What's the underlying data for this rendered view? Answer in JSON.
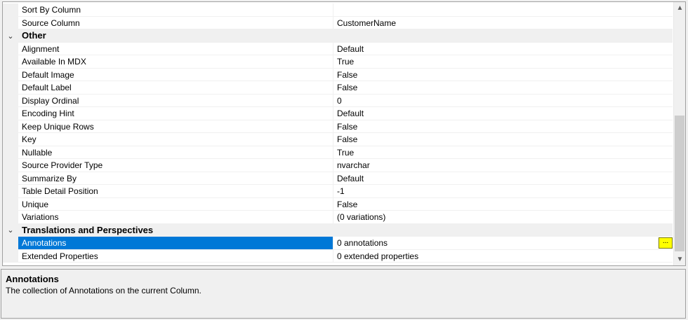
{
  "grid": {
    "rows": [
      {
        "type": "property",
        "name": "Sort By Column",
        "value": ""
      },
      {
        "type": "property",
        "name": "Source Column",
        "value": "CustomerName"
      },
      {
        "type": "category",
        "name": "Other",
        "toggle": "⌄"
      },
      {
        "type": "property",
        "name": "Alignment",
        "value": "Default"
      },
      {
        "type": "property",
        "name": "Available In MDX",
        "value": "True"
      },
      {
        "type": "property",
        "name": "Default Image",
        "value": "False"
      },
      {
        "type": "property",
        "name": "Default Label",
        "value": "False"
      },
      {
        "type": "property",
        "name": "Display Ordinal",
        "value": "0"
      },
      {
        "type": "property",
        "name": "Encoding Hint",
        "value": "Default"
      },
      {
        "type": "property",
        "name": "Keep Unique Rows",
        "value": "False"
      },
      {
        "type": "property",
        "name": "Key",
        "value": "False"
      },
      {
        "type": "property",
        "name": "Nullable",
        "value": "True"
      },
      {
        "type": "property",
        "name": "Source Provider Type",
        "value": "nvarchar"
      },
      {
        "type": "property",
        "name": "Summarize By",
        "value": "Default"
      },
      {
        "type": "property",
        "name": "Table Detail Position",
        "value": "-1"
      },
      {
        "type": "property",
        "name": "Unique",
        "value": "False"
      },
      {
        "type": "property",
        "name": "Variations",
        "value": "(0 variations)"
      },
      {
        "type": "category",
        "name": "Translations and Perspectives",
        "toggle": "⌄"
      },
      {
        "type": "property",
        "name": "Annotations",
        "value": "0 annotations",
        "selected": true,
        "button": "..."
      },
      {
        "type": "property",
        "name": "Extended Properties",
        "value": "0 extended properties"
      }
    ]
  },
  "description": {
    "title": "Annotations",
    "text": "The collection of Annotations on the current Column."
  },
  "colors": {
    "selection": "#0078d7",
    "highlight_button": "#ffff00"
  }
}
